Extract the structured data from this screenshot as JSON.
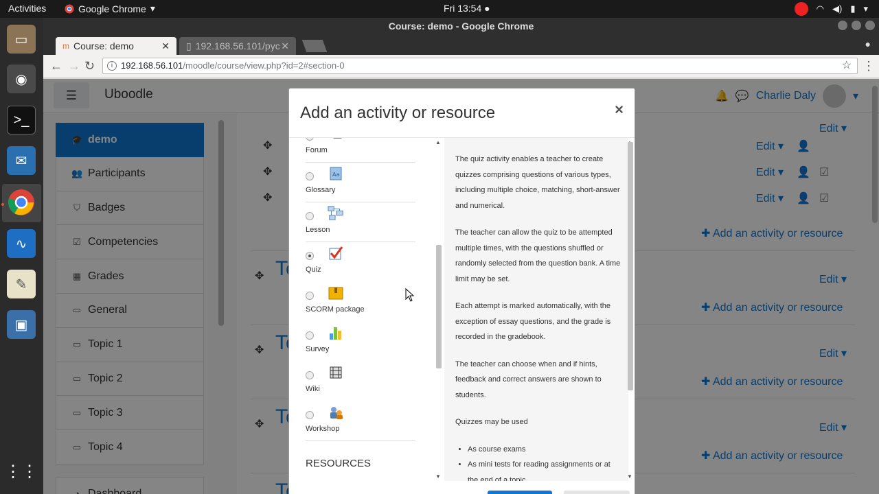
{
  "system": {
    "activities": "Activities",
    "app_name": "Google Chrome",
    "clock": "Fri 13:54 ●"
  },
  "window": {
    "title": "Course: demo - Google Chrome"
  },
  "tabs": [
    {
      "label": "Course: demo"
    },
    {
      "label": "192.168.56.101/pyc"
    }
  ],
  "omnibar": {
    "host": "192.168.56.101",
    "path": "/moodle/course/view.php?id=2#section-0"
  },
  "site": {
    "brand": "Uboodle",
    "user_name": "Charlie Daly"
  },
  "sidebar": {
    "items": [
      {
        "label": "demo",
        "icon": "graduation-cap-icon"
      },
      {
        "label": "Participants",
        "icon": "users-icon"
      },
      {
        "label": "Badges",
        "icon": "shield-icon"
      },
      {
        "label": "Competencies",
        "icon": "check-square-icon"
      },
      {
        "label": "Grades",
        "icon": "table-icon"
      },
      {
        "label": "General",
        "icon": "folder-icon"
      },
      {
        "label": "Topic 1",
        "icon": "folder-icon"
      },
      {
        "label": "Topic 2",
        "icon": "folder-icon"
      },
      {
        "label": "Topic 3",
        "icon": "folder-icon"
      },
      {
        "label": "Topic 4",
        "icon": "folder-icon"
      },
      {
        "label": "Dashboard",
        "icon": "dashboard-icon"
      }
    ]
  },
  "course": {
    "edit_label": "Edit",
    "add_activity_label": "Add an activity or resource",
    "topic_prefix": "To"
  },
  "modal": {
    "title": "Add an activity or resource",
    "close": "×",
    "options": [
      {
        "label": "Forum",
        "icon": "forum-icon"
      },
      {
        "label": "Glossary",
        "icon": "glossary-icon"
      },
      {
        "label": "Lesson",
        "icon": "lesson-icon"
      },
      {
        "label": "Quiz",
        "icon": "quiz-icon",
        "selected": true
      },
      {
        "label": "SCORM package",
        "icon": "scorm-icon"
      },
      {
        "label": "Survey",
        "icon": "survey-icon"
      },
      {
        "label": "Wiki",
        "icon": "wiki-icon"
      },
      {
        "label": "Workshop",
        "icon": "workshop-icon"
      }
    ],
    "resources_heading": "RESOURCES",
    "help": {
      "paragraphs": [
        "The quiz activity enables a teacher to create quizzes comprising questions of various types, including multiple choice, matching, short-answer and numerical.",
        "The teacher can allow the quiz to be attempted multiple times, with the questions shuffled or randomly selected from the question bank. A time limit may be set.",
        "Each attempt is marked automatically, with the exception of essay questions, and the grade is recorded in the gradebook.",
        "The teacher can choose when and if hints, feedback and correct answers are shown to students.",
        "Quizzes may be used"
      ],
      "bullets": [
        "As course exams",
        "As mini tests for reading assignments or at the end of a topic"
      ]
    }
  },
  "colors": {
    "accent": "#1177d1",
    "topbar": "#1a1a1a",
    "dock": "#2b2b2b"
  }
}
